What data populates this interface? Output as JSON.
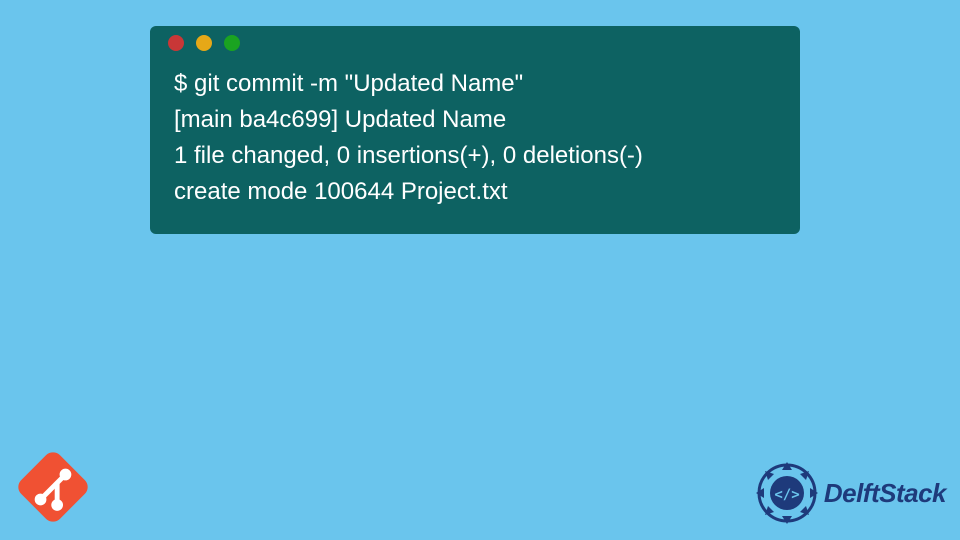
{
  "terminal": {
    "lines": [
      "$ git commit -m \"Updated Name\"",
      "[main ba4c699] Updated Name",
      " 1 file changed, 0 insertions(+), 0 deletions(-)",
      " create mode 100644 Project.txt"
    ]
  },
  "branding": {
    "delft_text": "DelftStack"
  },
  "colors": {
    "background": "#6ac5ed",
    "terminal_bg": "#0d6262",
    "git_orange": "#f05133",
    "delft_blue": "#1e3a7b"
  }
}
